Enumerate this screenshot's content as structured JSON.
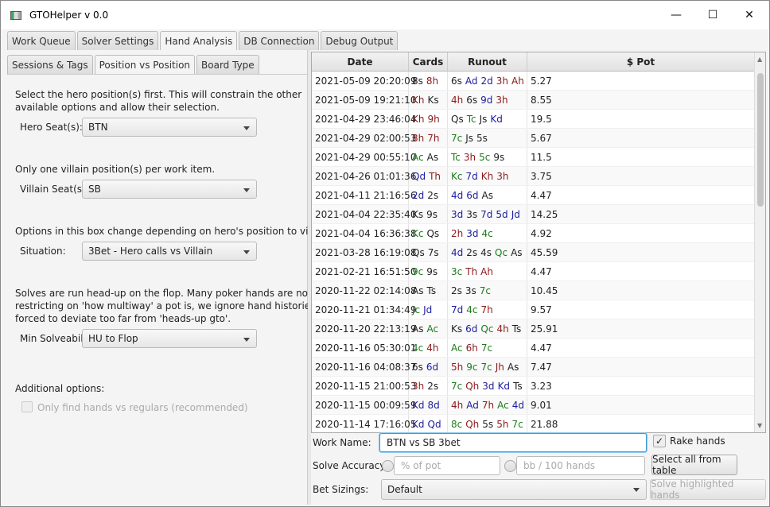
{
  "window": {
    "title": "GTOHelper v 0.0"
  },
  "main_tabs": [
    "Work Queue",
    "Solver Settings",
    "Hand Analysis",
    "DB Connection",
    "Debug Output"
  ],
  "active_main_tab": "Hand Analysis",
  "sub_tabs": [
    "Sessions & Tags",
    "Position vs Position",
    "Board Type"
  ],
  "active_sub_tab": "Position vs Position",
  "position_panel": {
    "hero_help": [
      "Select the hero position(s) first. This will constrain the other",
      "available options and allow their selection."
    ],
    "hero_label": "Hero Seat(s):",
    "hero_value": "BTN",
    "villain_help": "Only one villain position(s) per work item.",
    "villain_label": "Villain Seat(s):",
    "villain_value": "SB",
    "situation_help": "Options in this box change depending on hero's position to villain.",
    "situation_label": "Situation:",
    "situation_value": "3Bet - Hero calls vs Villain",
    "solve_help": [
      "Solves are run head-up on the flop. Many poker hands are not. By",
      "restricting on 'how multiway' a pot is, we ignore hand histories",
      "forced to deviate too far from 'heads-up gto'."
    ],
    "solve_label": "Min Solveability:",
    "solve_value": "HU to Flop",
    "additional_label": "Additional options:",
    "regulars_label": "Only find hands vs regulars (recommended)",
    "regulars_checked": false
  },
  "suit_colors": {
    "s": "#222222",
    "h": "#8b1a1a",
    "d": "#1c1c9c",
    "c": "#1d7a1d"
  },
  "table": {
    "columns": [
      "Date",
      "Cards",
      "Runout",
      "$ Pot"
    ],
    "rows": [
      [
        "2021-05-09 20:20:09",
        "8s 8h",
        "6s Ad 2d 3h Ah",
        "5.27"
      ],
      [
        "2021-05-09 19:21:10",
        "Kh Ks",
        "4h 6s 9d 3h",
        "8.55"
      ],
      [
        "2021-04-29 23:46:04",
        "Kh 9h",
        "Qs Tc Js Kd",
        "19.5"
      ],
      [
        "2021-04-29 02:00:53",
        "8h 7h",
        "7c Js 5s",
        "5.67"
      ],
      [
        "2021-04-29 00:55:10",
        "Ac As",
        "Tc 3h 5c 9s",
        "11.5"
      ],
      [
        "2021-04-26 01:01:36",
        "Qd Th",
        "Kc 7d Kh 3h",
        "3.75"
      ],
      [
        "2021-04-11 21:16:56",
        "2d 2s",
        "4d 6d As",
        "4.47"
      ],
      [
        "2021-04-04 22:35:40",
        "Ks 9s",
        "3d 3s 7d 5d Jd",
        "14.25"
      ],
      [
        "2021-04-04 16:36:38",
        "Kc Qs",
        "2h 3d 4c",
        "4.92"
      ],
      [
        "2021-03-28 16:19:08",
        "Qs 7s",
        "4d 2s 4s Qc As",
        "45.59"
      ],
      [
        "2021-02-21 16:51:50",
        "9c 9s",
        "3c Th Ah",
        "4.47"
      ],
      [
        "2020-11-22 02:14:08",
        "As Ts",
        "2s 3s 7c",
        "10.45"
      ],
      [
        "2020-11-21 01:34:49",
        "Jc Jd",
        "7d 4c 7h",
        "9.57"
      ],
      [
        "2020-11-20 22:13:19",
        "As Ac",
        "Ks 6d Qc 4h Ts",
        "25.91"
      ],
      [
        "2020-11-16 05:30:01",
        "4c 4h",
        "Ac 6h 7c",
        "4.47"
      ],
      [
        "2020-11-16 04:08:37",
        "6s 6d",
        "5h 9c 7c Jh As",
        "7.47"
      ],
      [
        "2020-11-15 21:00:53",
        "3h 2s",
        "7c Qh 3d Kd Ts",
        "3.23"
      ],
      [
        "2020-11-15 00:09:59",
        "Kd 8d",
        "4h Ad 7h Ac 4d",
        "9.01"
      ],
      [
        "2020-11-14 17:16:05",
        "Kd Qd",
        "8c Qh 5s 5h 7c",
        "21.88"
      ]
    ]
  },
  "bottom": {
    "work_name_label": "Work Name:",
    "work_name_value": "BTN vs SB 3bet",
    "rake_label": "Rake hands",
    "rake_checked": true,
    "accuracy_label": "Solve Accuracy:",
    "pct_placeholder": "% of pot",
    "bb_placeholder": "bb / 100 hands",
    "select_all_label": "Select all from table",
    "bet_label": "Bet Sizings:",
    "bet_value": "Default",
    "solve_label": "Solve highlighted hands"
  }
}
